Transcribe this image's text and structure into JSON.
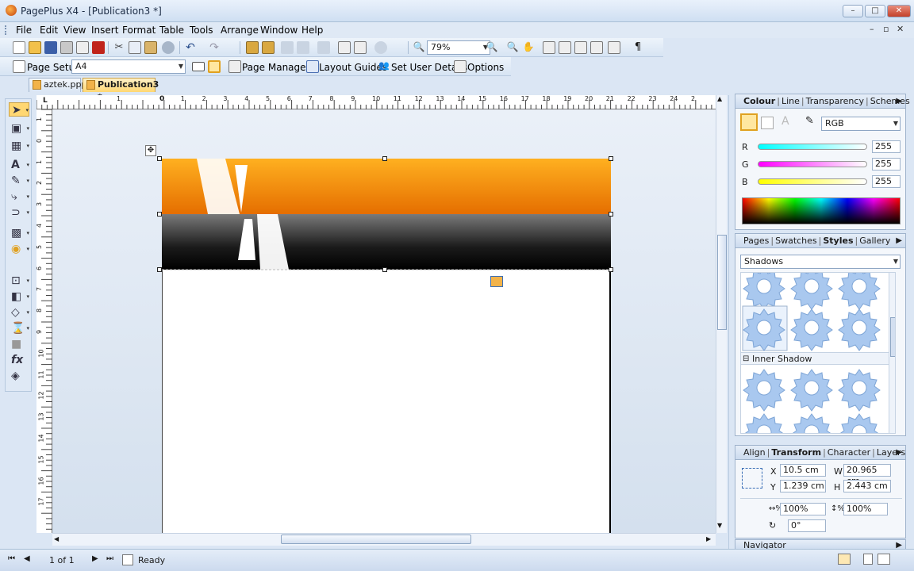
{
  "window": {
    "title": "PagePlus X4 - [Publication3 *]",
    "min": "–",
    "max": "□",
    "close": "✕"
  },
  "menu": [
    "File",
    "Edit",
    "View",
    "Insert",
    "Format",
    "Table",
    "Tools",
    "Arrange",
    "Window",
    "Help"
  ],
  "mdi_controls": {
    "min": "–",
    "restore": "▫",
    "close": "✕"
  },
  "toolbar": {
    "zoom": "79%"
  },
  "context_bar": {
    "page_setup": "Page Setup",
    "paper": "A4",
    "page_manager": "Page Manager",
    "layout_guides": "Layout Guides",
    "set_user_details": "Set User Details",
    "options": "Options"
  },
  "tabs": [
    {
      "label": "aztek.ppp"
    },
    {
      "label": "Publication3 *"
    }
  ],
  "ruler": {
    "top": [
      "1",
      "1",
      "2",
      "3",
      "4",
      "5",
      "6",
      "7",
      "8",
      "9",
      "10",
      "11",
      "12",
      "13",
      "14",
      "15",
      "16",
      "17",
      "18",
      "19",
      "20",
      "21",
      "22",
      "23",
      "24",
      "2"
    ],
    "top_zero": "0",
    "left": [
      "1",
      "0",
      "1",
      "2",
      "3",
      "4",
      "5",
      "6",
      "7",
      "8",
      "9",
      "10",
      "11",
      "12",
      "13",
      "14",
      "15",
      "16",
      "17"
    ]
  },
  "colour_panel": {
    "tabs": [
      "Colour",
      "Line",
      "Transparency",
      "Schemes"
    ],
    "mode": "RGB",
    "r_label": "R",
    "g_label": "G",
    "b_label": "B",
    "r": "255",
    "g": "255",
    "b": "255"
  },
  "styles_panel": {
    "tabs": [
      "Pages",
      "Swatches",
      "Styles",
      "Gallery"
    ],
    "category": "Shadows",
    "section": "Inner Shadow"
  },
  "transform_panel": {
    "tabs": [
      "Align",
      "Transform",
      "Character",
      "Layers"
    ],
    "x_label": "X",
    "x": "10.5 cm",
    "y_label": "Y",
    "y": "1.239 cm",
    "w_label": "W",
    "w": "20.965 cm",
    "h_label": "H",
    "h": "2.443 cm",
    "scale_x": "100%",
    "scale_y": "100%",
    "rotation": "0°"
  },
  "navigator": {
    "label": "Navigator"
  },
  "status": {
    "page": "1 of 1",
    "state": "Ready"
  },
  "colors": {
    "orange": "#f59a00",
    "accent": "#3b6fb6"
  }
}
